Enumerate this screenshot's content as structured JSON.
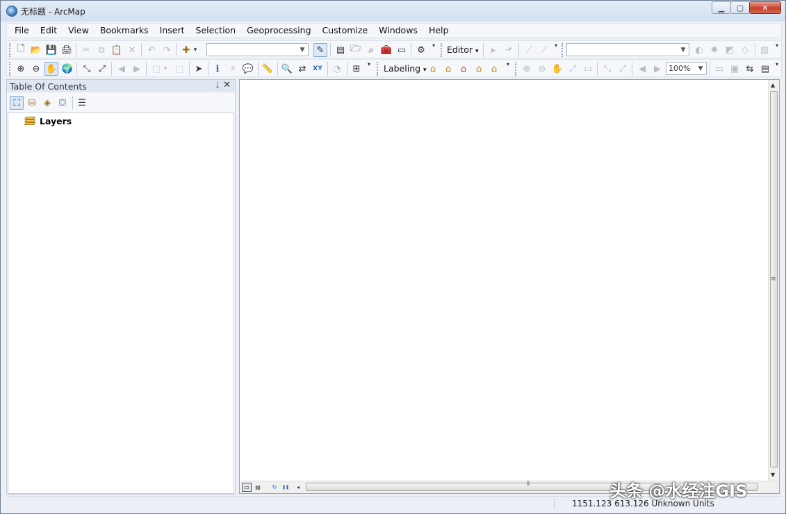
{
  "window": {
    "title": "无标题 - ArcMap",
    "caption": {
      "minimize": "▁",
      "maximize": "▢",
      "close": "✕"
    }
  },
  "menu": [
    "File",
    "Edit",
    "View",
    "Bookmarks",
    "Insert",
    "Selection",
    "Geoprocessing",
    "Customize",
    "Windows",
    "Help"
  ],
  "toolbar1": {
    "editor_label": "Editor",
    "editor_arrow": "▾",
    "scale_combo_value": "",
    "layer_combo_value": "",
    "icons": {
      "new": "🗋",
      "open": "📂",
      "save": "💾",
      "print": "🖨",
      "cut": "✂",
      "copy": "⧉",
      "paste": "📋",
      "delete": "✕",
      "undo": "↶",
      "redo": "↷",
      "add_data": "✚",
      "dropdown": "▾",
      "editor_toolbar": "✎",
      "table": "▤",
      "catalog": "🗁",
      "search": "⌕",
      "toolbox": "🧰",
      "python": "▭",
      "model": "⚙",
      "edit_tool": "▸",
      "sketch": "⬏",
      "line": "⟋",
      "curve": "⟋",
      "shade": "◐",
      "sun": "✹",
      "tile": "◩",
      "shape": "◇",
      "more": "▥"
    }
  },
  "toolbar2": {
    "labeling_label": "Labeling",
    "labeling_arrow": "▾",
    "zoom_value": "100%",
    "icons": {
      "zoom_in": "⊕",
      "zoom_out": "⊖",
      "pan": "✋",
      "full_extent": "🌍",
      "fixed_zoom_in": "⤡",
      "fixed_zoom_out": "⤢",
      "back": "◀",
      "forward": "▶",
      "select_features": "⬚",
      "clear_select": "⬚",
      "select_element": "➤",
      "identify": "ℹ",
      "hyperlink": "⚡",
      "html_popup": "💬",
      "measure": "📏",
      "find": "🔍",
      "route": "⇄",
      "goto_xy": "XY",
      "time_slider": "◔",
      "magnifier": "⊞",
      "label_manager": "⌂",
      "label_priority": "⌂",
      "label_weight": "⌂",
      "lock_labels": "⌂",
      "view_unplaced": "⌂",
      "layout_zoom_in": "⊕",
      "layout_zoom_out": "⊖",
      "layout_pan": "✋",
      "zoom_whole": "⤢",
      "zoom_100": "1:1",
      "fixed_in": "⤡",
      "fixed_out": "⤢",
      "prev_extent": "◀",
      "next_extent": "▶",
      "toggle_draft": "▭",
      "focus_frame": "▣",
      "change_layout": "⇆",
      "data_driven": "▤"
    }
  },
  "toc": {
    "title": "Table Of Contents",
    "pin": "ᛣ",
    "close": "✕",
    "tool_icons": {
      "list_drawing_order": "⛶",
      "list_source": "⛁",
      "list_visibility": "◈",
      "list_selection": "⛋",
      "options": "☰"
    },
    "root_label": "Layers"
  },
  "map": {
    "bottom_icons": {
      "data_view": "▭",
      "layout_view": "▤",
      "refresh": "↻",
      "pause": "❚❚",
      "scroll_left": "◂"
    }
  },
  "status": {
    "coordinates": "1151.123  613.126 Unknown Units"
  },
  "watermark": "头条 @水经注GIS"
}
